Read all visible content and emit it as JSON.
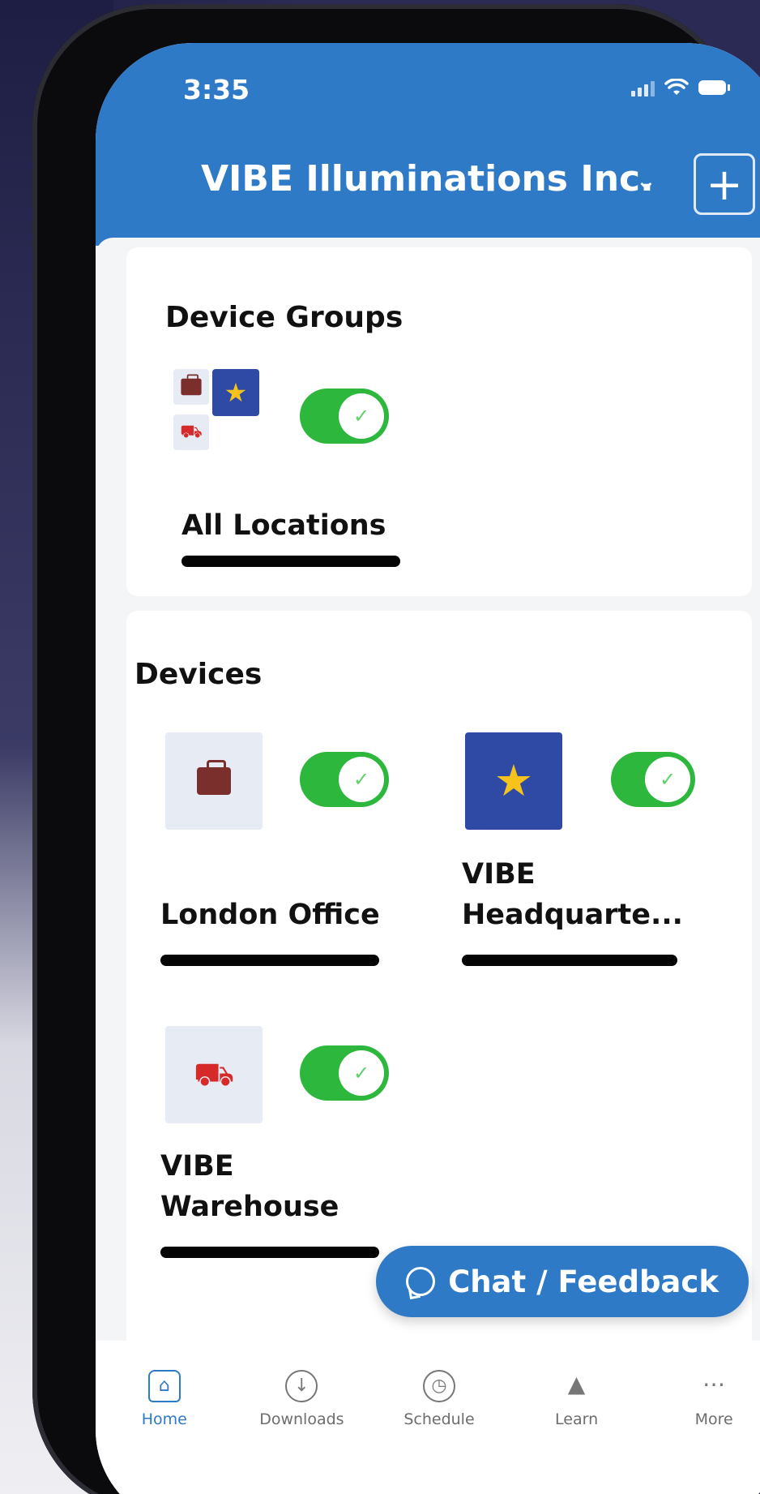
{
  "status": {
    "time": "3:35"
  },
  "header": {
    "org_name": "VIBE Illuminations Inc.",
    "add_label": "+"
  },
  "device_groups": {
    "title": "Device Groups",
    "group": {
      "name": "All Locations",
      "enabled": true
    }
  },
  "devices": {
    "title": "Devices",
    "items": [
      {
        "name": "London Office",
        "icon": "briefcase-icon",
        "enabled": true
      },
      {
        "name_line1": "VIBE",
        "name_line2": "Headquarte...",
        "icon": "star-icon",
        "enabled": true
      },
      {
        "name_line1": "VIBE",
        "name_line2": "Warehouse",
        "icon": "truck-icon",
        "enabled": true
      }
    ]
  },
  "chat": {
    "label": "Chat / Feedback"
  },
  "tabs": [
    {
      "label": "Home",
      "icon": "home-icon",
      "active": true
    },
    {
      "label": "Downloads",
      "icon": "download-icon",
      "active": false
    },
    {
      "label": "Schedule",
      "icon": "schedule-icon",
      "active": false
    },
    {
      "label": "Learn",
      "icon": "graduation-cap-icon",
      "active": false
    },
    {
      "label": "More",
      "icon": "more-icon",
      "active": false
    }
  ],
  "colors": {
    "primary": "#2f7ac7",
    "toggle_on": "#2db83d",
    "star_tile": "#2f4aa5"
  }
}
